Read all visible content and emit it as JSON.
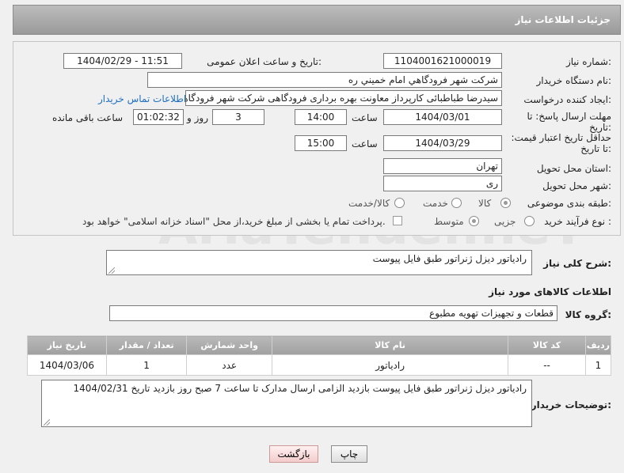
{
  "header": {
    "title": "جزئیات اطلاعات نیاز"
  },
  "form": {
    "need_number_label": "شماره نیاز:",
    "need_number": "1104001621000019",
    "announce_label": "تاریخ و ساعت اعلان عمومی:",
    "announce_value": "1404/02/29 - 11:51",
    "buyer_org_label": "نام دستگاه خریدار:",
    "buyer_org": "شرکت شهر فرودگاهي امام خميني  ره",
    "creator_label": "ایجاد کننده درخواست:",
    "creator": "سیدرضا طباطبائی کارپرداز معاونت بهره برداری فرودگاهی شرکت شهر فرودگاهی امام",
    "contact_link": "اطلاعات تماس خریدار",
    "reply_deadline_label": "مهلت ارسال پاسخ: تا تاریخ:",
    "reply_date": "1404/03/01",
    "time_label": "ساعت",
    "reply_time": "14:00",
    "days_value": "3",
    "days_label": "روز و",
    "remaining_time": "01:02:32",
    "remaining_label": "ساعت باقی مانده",
    "price_deadline_label": "حداقل تاریخ اعتبار قیمت: تا تاریخ:",
    "price_date": "1404/03/29",
    "price_time": "15:00",
    "province_label": "استان محل تحویل:",
    "province": "تهران",
    "city_label": "شهر محل تحویل:",
    "city": "ری",
    "category_label": "طبقه بندی موضوعی:",
    "cat_goods": "کالا",
    "cat_service": "خدمت",
    "cat_both": "کالا/خدمت",
    "process_label": "نوع فرآیند خرید :",
    "proc_partial": "جزیی",
    "proc_medium": "متوسط",
    "payment_note": "پرداخت تمام یا بخشی از مبلغ خرید،از محل \"اسناد خزانه اسلامی\" خواهد بود."
  },
  "description": {
    "label": "شرح کلی نیاز:",
    "value": "رادیاتور دیزل ژنراتور طبق فایل پیوست"
  },
  "goods": {
    "section_title": "اطلاعات کالاهای مورد نیاز",
    "group_label": "گروه کالا:",
    "group_value": "قطعات و تجهیزات تهویه مطبوع",
    "columns": [
      "ردیف",
      "کد کالا",
      "نام کالا",
      "واحد شمارش",
      "تعداد / مقدار",
      "تاریخ نیاز"
    ],
    "rows": [
      [
        "1",
        "--",
        "رادیاتور",
        "عدد",
        "1",
        "1404/03/06"
      ]
    ]
  },
  "buyer_notes": {
    "label": "توضیحات خریدار:",
    "value": "رادیاتور دیزل ژنراتور طبق فایل پیوست بازدید الزامی ارسال مدارک تا ساعت 7 صبح  روز بازدید تاریخ 1404/02/31"
  },
  "buttons": {
    "print": "چاپ",
    "back": "بازگشت"
  },
  "watermark": "AriaTender.neT"
}
